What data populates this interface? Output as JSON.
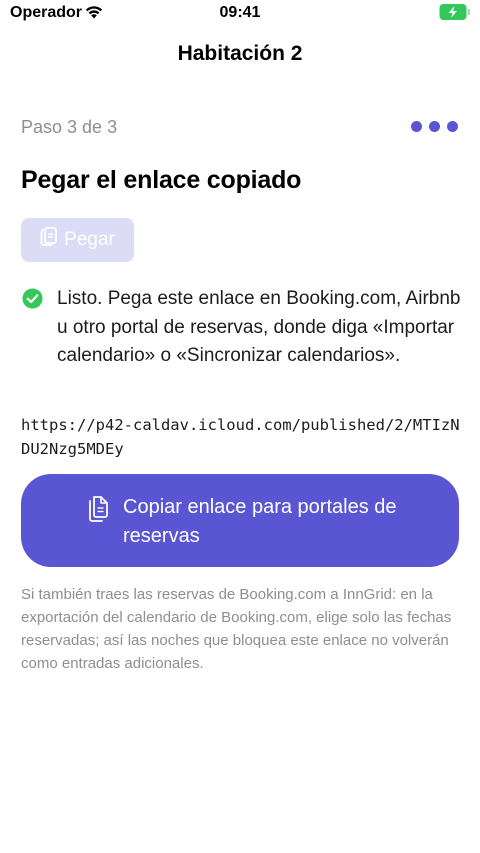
{
  "status_bar": {
    "carrier": "Operador",
    "time": "09:41"
  },
  "nav": {
    "title": "Habitación 2"
  },
  "step": {
    "label": "Paso 3 de 3",
    "total": 3,
    "current": 3
  },
  "heading": "Pegar el enlace copiado",
  "paste_button": {
    "label": "Pegar"
  },
  "ready": {
    "text": "Listo. Pega este enlace en Booking.com, Airbnb u otro portal de reservas, donde diga «Importar calendario» o «Sincronizar calendarios»."
  },
  "link": "https://p42-caldav.icloud.com/published/2/MTIzNDU2Nzg5MDEy",
  "copy_button": {
    "label": "Copiar enlace para portales de reservas"
  },
  "footnote": "Si también traes las reservas de Booking.com a InnGrid: en la exportación del calendario de Booking.com, elige solo las fechas reservadas; así las noches que bloquea este enlace no volverán como entradas adicionales.",
  "colors": {
    "accent": "#5a55d2",
    "success": "#34c759",
    "battery": "#34c759",
    "paste_disabled": "#dcdcf6"
  },
  "icons": {
    "wifi": "wifi-icon",
    "battery": "battery-charging-icon",
    "paste": "clipboard-icon",
    "check": "checkmark-circle-icon",
    "copy": "documents-icon"
  }
}
